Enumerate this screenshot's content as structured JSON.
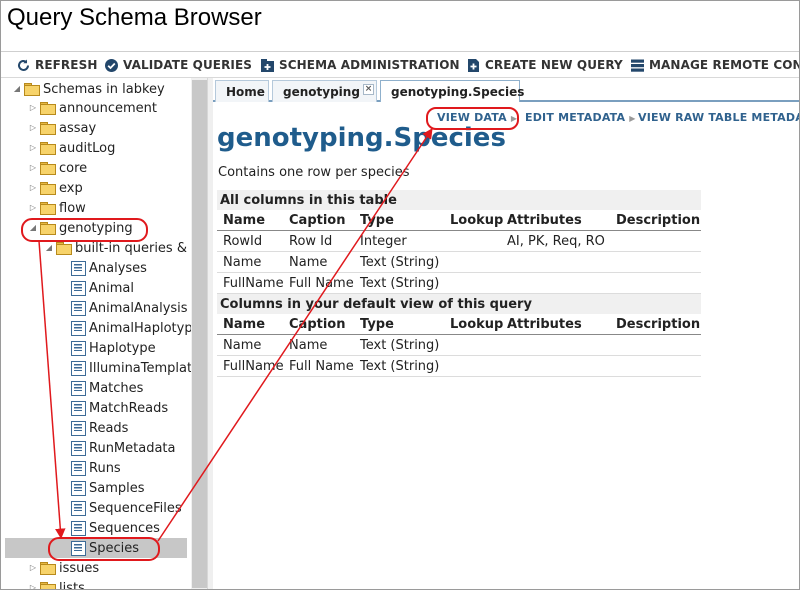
{
  "app": {
    "title": "Query Schema Browser"
  },
  "toolbar": {
    "refresh": "REFRESH",
    "validate": "VALIDATE QUERIES",
    "schema_admin": "SCHEMA ADMINISTRATION",
    "create_query": "CREATE NEW QUERY",
    "manage_remote": "MANAGE REMOTE CONNECTIONS"
  },
  "tree": {
    "root": "Schemas in labkey",
    "schemas": [
      "announcement",
      "assay",
      "auditLog",
      "core",
      "exp",
      "flow"
    ],
    "genotyping": "genotyping",
    "builtin": "built-in queries & tables",
    "queries": [
      "Analyses",
      "Animal",
      "AnimalAnalysis",
      "AnimalHaplotype",
      "Haplotype",
      "IlluminaTemplates",
      "Matches",
      "MatchReads",
      "Reads",
      "RunMetadata",
      "Runs",
      "Samples",
      "SequenceFiles",
      "Sequences"
    ],
    "selected": "Species",
    "after": [
      "issues",
      "lists"
    ]
  },
  "tabs": [
    {
      "label": "Home"
    },
    {
      "label": "genotyping",
      "close": "×"
    },
    {
      "label": "genotyping.Species"
    }
  ],
  "actions": {
    "view_data": "VIEW DATA",
    "edit_metadata": "EDIT METADATA",
    "view_raw": "VIEW RAW TABLE METADATA"
  },
  "main": {
    "title": "genotyping.Species",
    "description": "Contains one row per species"
  },
  "table": {
    "section_all": "All columns in this table",
    "section_default": "Columns in your default view of this query",
    "headers": [
      "Name",
      "Caption",
      "Type",
      "Lookup",
      "Attributes",
      "Description"
    ],
    "all_rows": [
      [
        "RowId",
        "Row Id",
        "Integer",
        "",
        "AI, PK, Req, RO",
        ""
      ],
      [
        "Name",
        "Name",
        "Text (String)",
        "",
        "",
        ""
      ],
      [
        "FullName",
        "Full Name",
        "Text (String)",
        "",
        "",
        ""
      ]
    ],
    "default_rows": [
      [
        "Name",
        "Name",
        "Text (String)",
        "",
        "",
        ""
      ],
      [
        "FullName",
        "Full Name",
        "Text (String)",
        "",
        "",
        ""
      ]
    ]
  },
  "colors": {
    "accent": "#1f5c8c",
    "link": "#30628e",
    "annotation": "#e0191d"
  }
}
